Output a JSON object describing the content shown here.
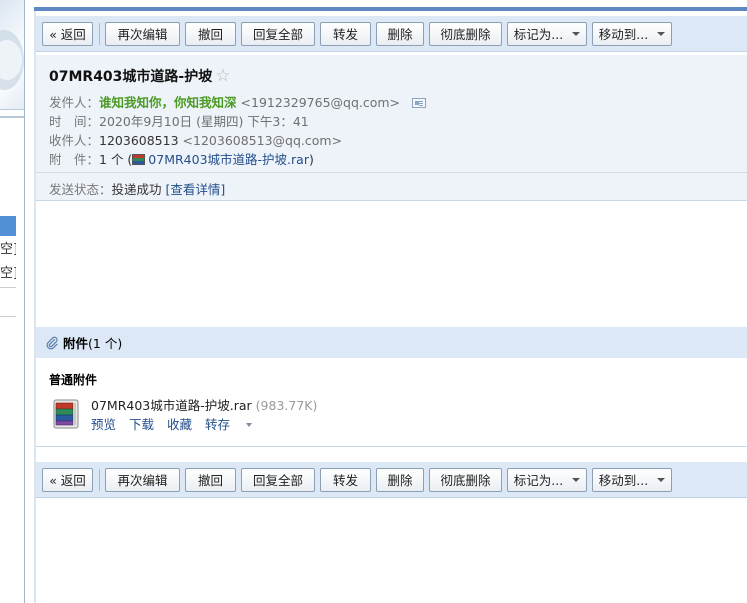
{
  "toolbar": {
    "back": "« 返回",
    "reedit": "再次编辑",
    "recall": "撤回",
    "reply_all": "回复全部",
    "forward": "转发",
    "delete": "删除",
    "delete_perm": "彻底删除",
    "mark_as": "标记为...",
    "move_to": "移动到..."
  },
  "mail": {
    "subject": "07MR403城市道路-护坡",
    "star": "☆",
    "from_label": "发件人：",
    "from_name": "谁知我知你，你知我知深",
    "from_email": "<1912329765@qq.com>",
    "time_label": "时　间：",
    "time_value": "2020年9月10日 (星期四) 下午3：41",
    "to_label": "收件人：",
    "to_name": "1203608513",
    "to_email": "<1203608513@qq.com>",
    "attach_label": "附　件：",
    "attach_count": "1 个 (",
    "attach_file": "07MR403城市道路-护坡.rar",
    "attach_close": ")",
    "status_label": "发送状态：",
    "status_value": "投递成功",
    "status_detail": "[查看详情]"
  },
  "attachments": {
    "header_label": "附件",
    "header_count": "(1 个)",
    "section_title": "普通附件",
    "file_name": "07MR403城市道路-护坡.rar",
    "file_size": "(983.77K)",
    "actions": {
      "preview": "预览",
      "download": "下载",
      "collect": "收藏",
      "save_to": "转存"
    }
  },
  "sidebar": {
    "fragment_1": "空]",
    "fragment_2": "空]"
  },
  "icons": {
    "star": "star-icon",
    "contact": "contact-card-icon",
    "rar": "rar-file-icon",
    "clip": "paperclip-icon"
  },
  "colors": {
    "toolbar_bg": "#dce8f5",
    "header_bg": "#eef3f9",
    "frame_accent": "#5d88c3",
    "link": "#234f8c",
    "sender_green": "#4a9a24"
  }
}
